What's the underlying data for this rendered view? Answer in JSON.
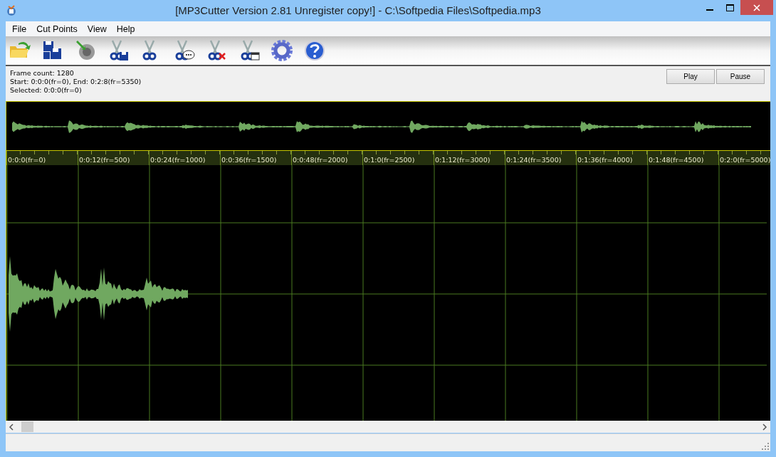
{
  "window": {
    "title": "[MP3Cutter Version 2.81 Unregister copy!] - C:\\Softpedia Files\\Softpedia.mp3"
  },
  "menu": [
    "File",
    "Cut Points",
    "View",
    "Help"
  ],
  "info": [
    "Frame count: 1280",
    "Start: 0:0:0(fr=0), End: 0:2:8(fr=5350)",
    "Selected: 0:0:0(fr=0)"
  ],
  "buttons": [
    "Play",
    "Pause"
  ],
  "ruler": [
    "0:0:0(fr=0)",
    "0:0:12(fr=500)",
    "0:0:24(fr=1000)",
    "0:0:36(fr=1500)",
    "0:0:48(fr=2000)",
    "0:1:0(fr=2500)",
    "0:1:12(fr=3000)",
    "0:1:24(fr=3500)",
    "0:1:36(fr=4000)",
    "0:1:48(fr=4500)",
    "0:2:0(fr=5000)"
  ]
}
